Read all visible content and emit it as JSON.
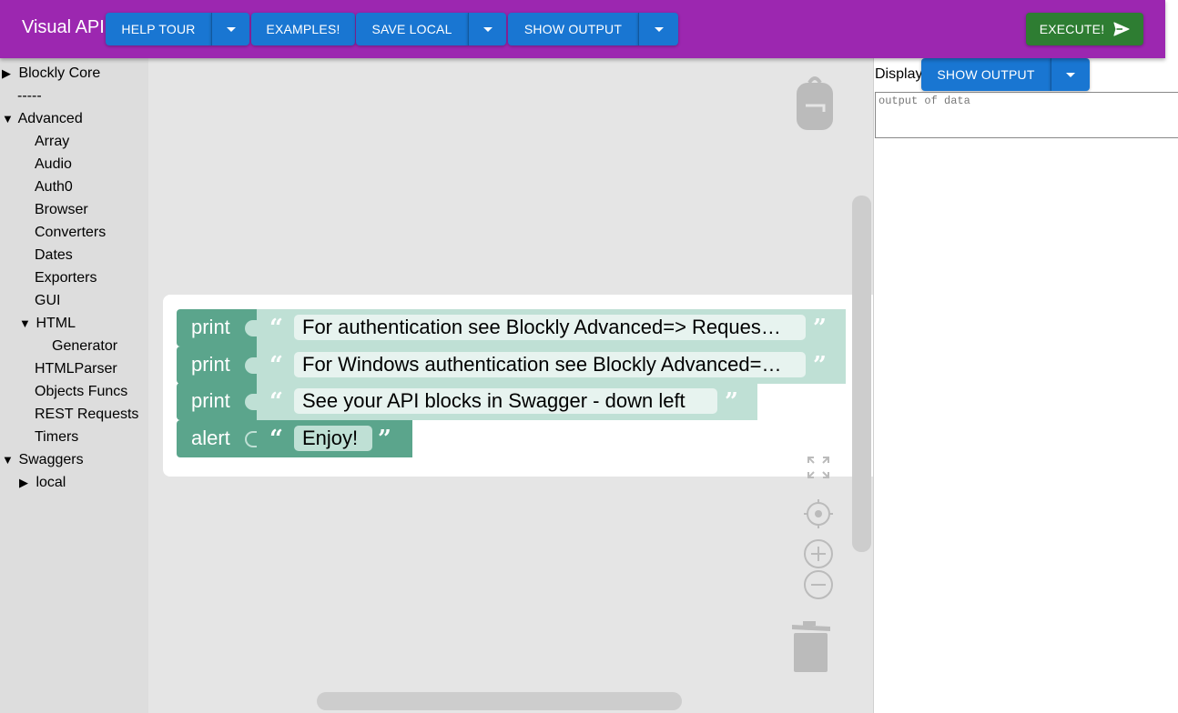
{
  "header": {
    "title": "Visual API",
    "help_tour": "HELP TOUR",
    "examples": "EXAMPLES!",
    "save_local": "SAVE LOCAL",
    "show_output": "SHOW OUTPUT",
    "execute": "EXECUTE!",
    "bg_color": "#9c27b0"
  },
  "sidebar": {
    "items": [
      {
        "label": "Blockly Core",
        "state": "collapsed"
      },
      {
        "label": "-----"
      },
      {
        "label": "Advanced",
        "state": "expanded"
      },
      {
        "label": "Array"
      },
      {
        "label": "Audio"
      },
      {
        "label": "Auth0"
      },
      {
        "label": "Browser"
      },
      {
        "label": "Converters"
      },
      {
        "label": "Dates"
      },
      {
        "label": "Exporters"
      },
      {
        "label": "GUI"
      },
      {
        "label": "HTML",
        "state": "expanded"
      },
      {
        "label": "Generator"
      },
      {
        "label": "HTMLParser"
      },
      {
        "label": "Objects Funcs"
      },
      {
        "label": "REST Requests"
      },
      {
        "label": "Timers"
      },
      {
        "label": "Swaggers",
        "state": "expanded"
      },
      {
        "label": "local",
        "state": "collapsed"
      }
    ]
  },
  "workspace": {
    "blocks": [
      {
        "keyword": "print",
        "text": "For authentication see Blockly Advanced=> Reques…"
      },
      {
        "keyword": "print",
        "text": "For Windows authentication see Blockly Advanced=…"
      },
      {
        "keyword": "print",
        "text": "See your API blocks in Swagger - down left"
      },
      {
        "keyword": "alert",
        "text": "Enjoy!"
      }
    ],
    "block_color": "#5ba58c",
    "string_color": "#bfe0d5",
    "icons": [
      "backpack-icon",
      "fullscreen-icon",
      "recenter-icon",
      "zoom-in-icon",
      "zoom-out-icon",
      "trash-icon"
    ]
  },
  "output_panel": {
    "display_label": "Display",
    "show_output": "SHOW OUTPUT",
    "placeholder": "output of data"
  }
}
